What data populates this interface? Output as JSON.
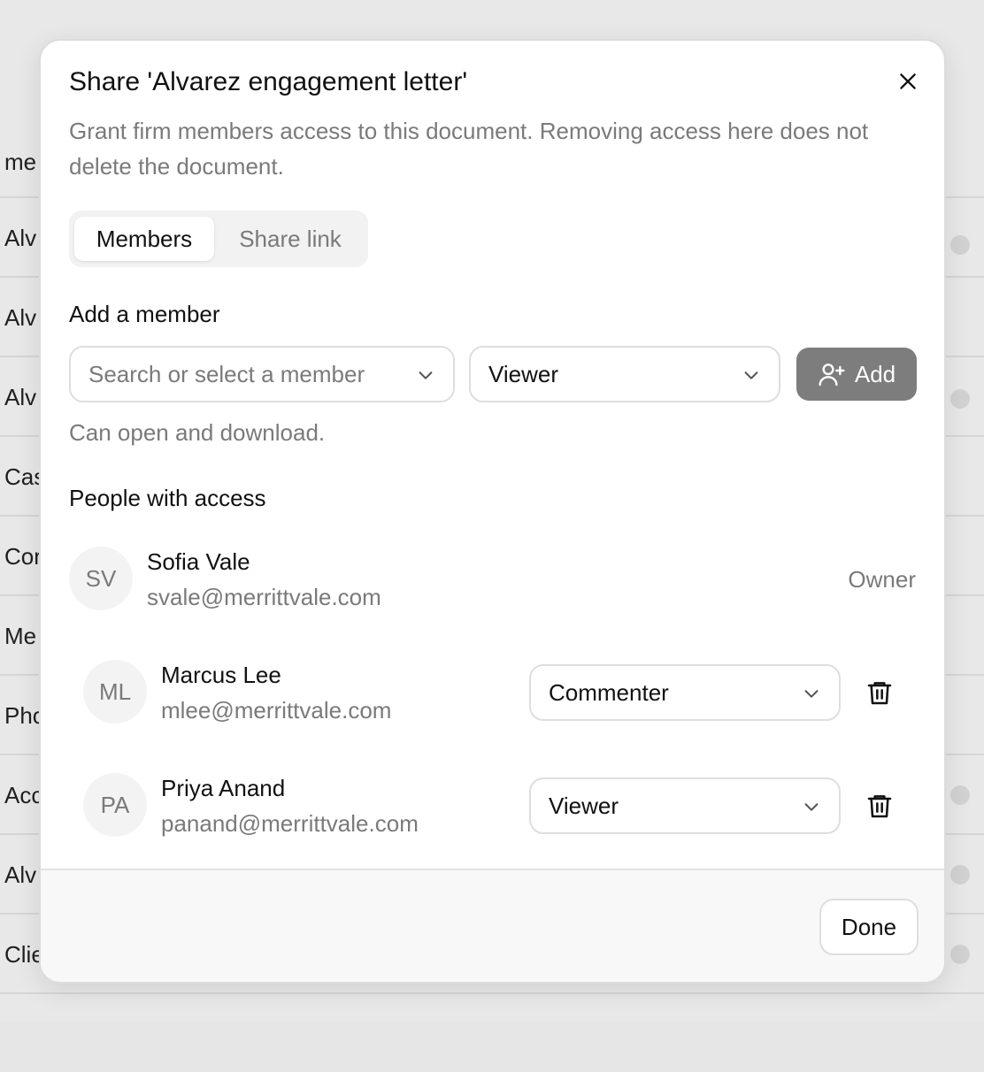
{
  "background": {
    "rows": [
      "me",
      "Alv",
      "Alv",
      "Alv",
      "Cas",
      "Cor",
      "Me",
      "Pho",
      "Acc",
      "Alv",
      "Clie"
    ]
  },
  "dialog": {
    "title": "Share 'Alvarez engagement letter'",
    "description": "Grant firm members access to this document. Removing access here does not delete the document.",
    "tabs": [
      {
        "label": "Members",
        "active": true
      },
      {
        "label": "Share link",
        "active": false
      }
    ],
    "add_member": {
      "label": "Add a member",
      "member_placeholder": "Search or select a member",
      "role_value": "Viewer",
      "add_label": "Add",
      "hint": "Can open and download."
    },
    "people_label": "People with access",
    "people": [
      {
        "initials": "SV",
        "name": "Sofia Vale",
        "email": "svale@merrittvale.com",
        "role": "Owner"
      },
      {
        "initials": "ML",
        "name": "Marcus Lee",
        "email": "mlee@merrittvale.com",
        "role": "Commenter"
      },
      {
        "initials": "PA",
        "name": "Priya Anand",
        "email": "panand@merrittvale.com",
        "role": "Viewer"
      }
    ],
    "done_label": "Done"
  },
  "icons": {
    "close": "close-icon",
    "chevron": "chevron-down-icon",
    "add": "user-plus-icon",
    "delete": "trash-icon"
  },
  "colors": {
    "add_button": "#7d7d7d",
    "muted_text": "#7a7a7a"
  }
}
